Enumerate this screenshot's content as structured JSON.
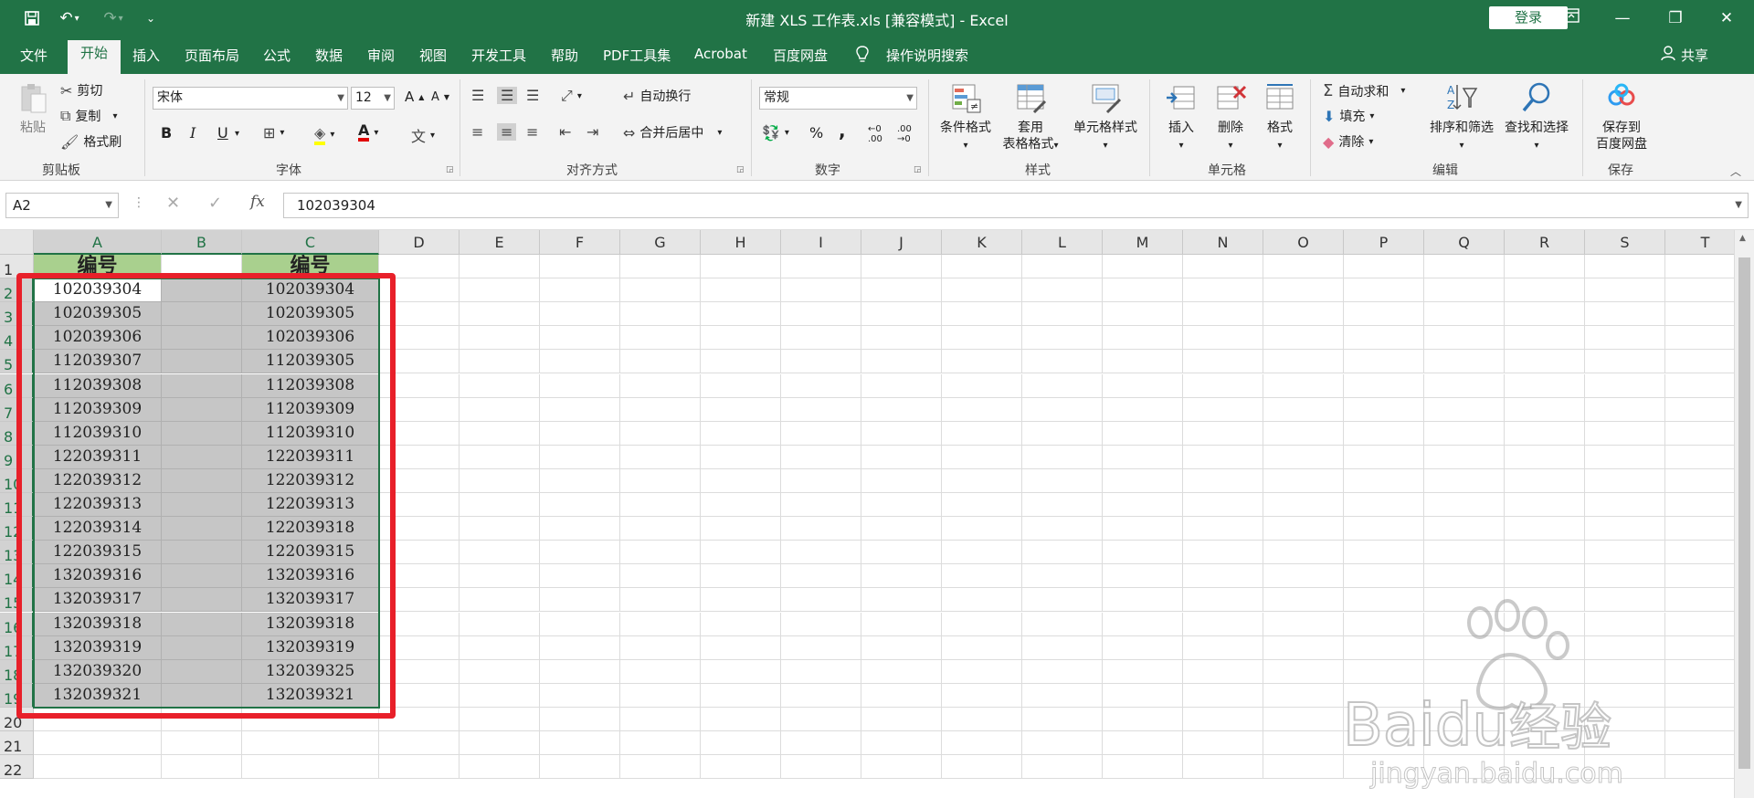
{
  "window": {
    "title": "新建 XLS 工作表.xls  [兼容模式]  -  Excel",
    "login_label": "登录"
  },
  "tabs": [
    "文件",
    "开始",
    "插入",
    "页面布局",
    "公式",
    "数据",
    "审阅",
    "视图",
    "开发工具",
    "帮助",
    "PDF工具集",
    "Acrobat",
    "百度网盘"
  ],
  "active_tab": "开始",
  "tell_me": "操作说明搜索",
  "share_label": "共享",
  "ribbon": {
    "clipboard": {
      "paste": "粘贴",
      "cut": "剪切",
      "copy": "复制",
      "format_painter": "格式刷",
      "label": "剪贴板"
    },
    "font": {
      "name": "宋体",
      "size": "12",
      "label": "字体",
      "bold": "B",
      "italic": "I",
      "underline": "U",
      "grow": "A",
      "shrink": "A",
      "font_color": "A",
      "phonetic": "文"
    },
    "alignment": {
      "wrap": "自动换行",
      "merge": "合并后居中",
      "label": "对齐方式"
    },
    "number": {
      "format": "常规",
      "label": "数字",
      "percent": "%",
      "comma": ","
    },
    "styles": {
      "conditional": "条件格式",
      "table_1": "套用",
      "table_2": "表格格式",
      "cell_style": "单元格样式",
      "label": "样式"
    },
    "cells": {
      "insert": "插入",
      "delete": "删除",
      "format": "格式",
      "label": "单元格"
    },
    "editing": {
      "autosum": "自动求和",
      "fill": "填充",
      "clear": "清除",
      "sort": "排序和筛选",
      "find": "查找和选择",
      "label": "编辑"
    },
    "save": {
      "label_1": "保存到",
      "label_2": "百度网盘",
      "group": "保存"
    }
  },
  "formula_bar": {
    "name_box": "A2",
    "value": "102039304",
    "fx": "fx"
  },
  "sheet": {
    "columns": [
      "A",
      "B",
      "C",
      "D",
      "E",
      "F",
      "G",
      "H",
      "I",
      "J",
      "K",
      "L",
      "M",
      "N",
      "O",
      "P",
      "Q",
      "R",
      "S",
      "T"
    ],
    "rows": [
      "1",
      "2",
      "3",
      "4",
      "5",
      "6",
      "7",
      "8",
      "9",
      "10",
      "11",
      "12",
      "13",
      "14",
      "15",
      "16",
      "17",
      "18",
      "19",
      "20",
      "21",
      "22"
    ],
    "header_A": "编号",
    "header_C": "编号",
    "colA": [
      "102039304",
      "102039305",
      "102039306",
      "112039307",
      "112039308",
      "112039309",
      "112039310",
      "122039311",
      "122039312",
      "122039313",
      "122039314",
      "122039315",
      "132039316",
      "132039317",
      "132039318",
      "132039319",
      "132039320",
      "132039321"
    ],
    "colC": [
      "102039304",
      "102039305",
      "102039306",
      "112039305",
      "112039308",
      "112039309",
      "112039310",
      "122039311",
      "122039312",
      "122039313",
      "122039318",
      "122039315",
      "132039316",
      "132039317",
      "132039318",
      "132039319",
      "132039325",
      "132039321"
    ]
  },
  "watermark": {
    "brand": "Baidu",
    "suffix": "经验",
    "url": "jingyan.baidu.com"
  },
  "colors": {
    "excel_green": "#217346",
    "header_fill": "#a9d08e",
    "selection_fill": "#c6c6c6",
    "annotation_red": "#e8202a"
  }
}
